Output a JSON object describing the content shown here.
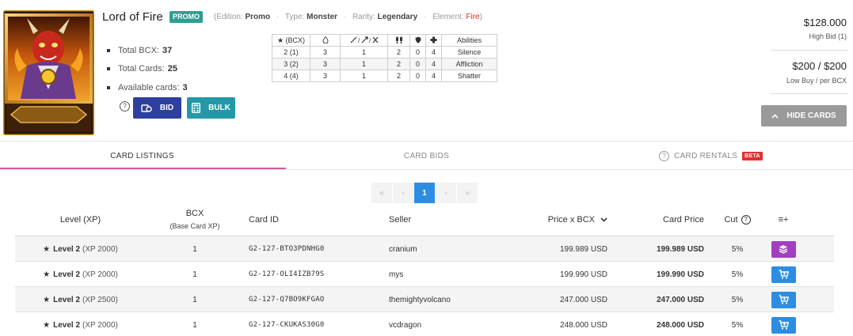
{
  "card": {
    "name": "Lord of Fire",
    "badge": "PROMO",
    "edition_label": "(Edition:",
    "edition": "Promo",
    "type_label": "Type:",
    "type": "Monster",
    "rarity_label": "Rarity:",
    "rarity": "Legendary",
    "element_label": "Element:",
    "element": "Fire",
    "element_close": ")",
    "element_color": "#e0281e"
  },
  "stats": [
    {
      "label": "Total BCX:",
      "value": "37"
    },
    {
      "label": "Total Cards:",
      "value": "25"
    },
    {
      "label": "Available cards:",
      "value": "3"
    }
  ],
  "actions": {
    "bid": "BID",
    "bulk": "BULK",
    "hide_cards": "HIDE CARDS"
  },
  "level_table": {
    "headers": [
      "★ (BCX)",
      "",
      "",
      "",
      "",
      "",
      "Abilities"
    ],
    "rows": [
      [
        "2 (1)",
        "3",
        "1",
        "2",
        "0",
        "4",
        "Silence"
      ],
      [
        "3 (2)",
        "3",
        "1",
        "2",
        "0",
        "4",
        "Affliction"
      ],
      [
        "4 (4)",
        "3",
        "1",
        "2",
        "0",
        "4",
        "Shatter"
      ]
    ]
  },
  "prices": {
    "high_bid": "$128.000",
    "high_bid_label": "High Bid (1)",
    "low_buy": "$200 / $200",
    "low_buy_label": "Low Buy / per BCX"
  },
  "tabs": [
    {
      "label": "CARD LISTINGS"
    },
    {
      "label": "CARD BIDS"
    },
    {
      "label": "CARD RENTALS",
      "badge": "BETA"
    }
  ],
  "pagination": {
    "first": "«",
    "prev": "‹",
    "current": "1",
    "next": "›",
    "last": "»"
  },
  "listings": {
    "headers": {
      "level": "Level (XP)",
      "bcx": "BCX",
      "bcx_sub": "(Base Card XP)",
      "card_id": "Card ID",
      "seller": "Seller",
      "price_bcx": "Price x BCX",
      "card_price": "Card Price",
      "cut": "Cut",
      "menu": "≡+"
    },
    "rows": [
      {
        "level": "Level 2",
        "xp": "(XP 2000)",
        "bcx": "1",
        "id": "G2-127-BTO3PDNHG0",
        "seller": "cranium",
        "price_bcx": "199.989 USD",
        "card_price": "199.989 USD",
        "cut": "5%",
        "action": "stack"
      },
      {
        "level": "Level 2",
        "xp": "(XP 2000)",
        "bcx": "1",
        "id": "G2-127-OLI4IZB79S",
        "seller": "mys",
        "price_bcx": "199.990 USD",
        "card_price": "199.990 USD",
        "cut": "5%",
        "action": "cart"
      },
      {
        "level": "Level 2",
        "xp": "(XP 2500)",
        "bcx": "1",
        "id": "G2-127-Q7BO9KFGAO",
        "seller": "themightyvolcano",
        "price_bcx": "247.000 USD",
        "card_price": "247.000 USD",
        "cut": "5%",
        "action": "cart"
      },
      {
        "level": "Level 2",
        "xp": "(XP 2000)",
        "bcx": "1",
        "id": "G2-127-CKUKAS30G0",
        "seller": "vcdragon",
        "price_bcx": "248.000 USD",
        "card_price": "248.000 USD",
        "cut": "5%",
        "action": "cart"
      }
    ]
  }
}
